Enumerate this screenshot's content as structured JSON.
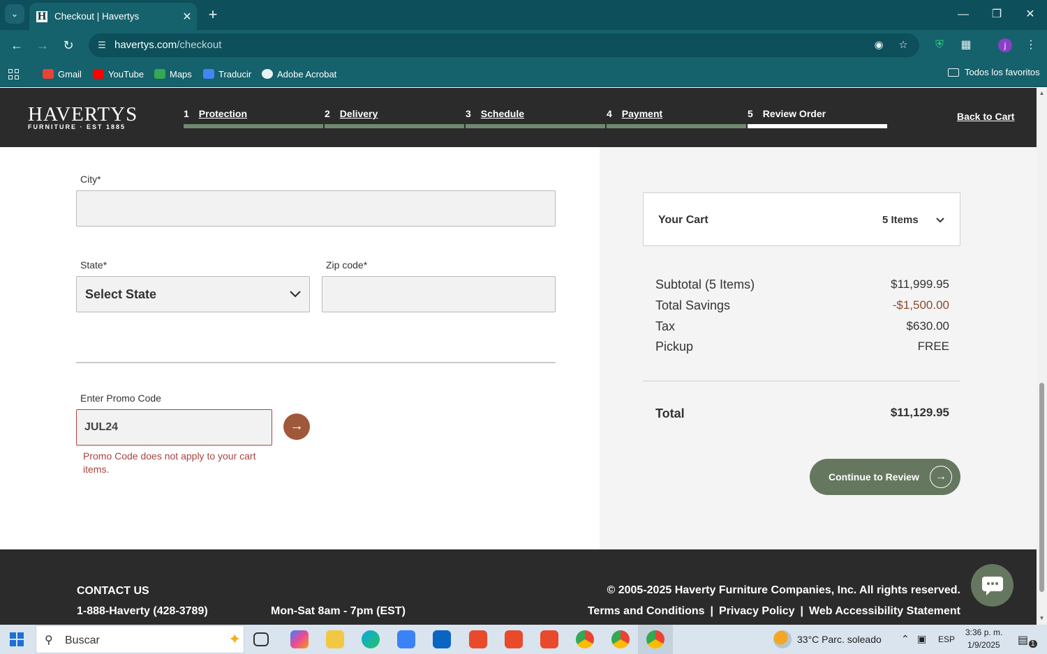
{
  "browser": {
    "tab_title": "Checkout | Havertys",
    "favicon_letter": "H",
    "url_host": "havertys.com",
    "url_path": "/checkout",
    "profile_initial": "j",
    "bookmarks": [
      "Gmail",
      "YouTube",
      "Maps",
      "Traducir",
      "Adobe Acrobat"
    ],
    "bookmarks_folder": "Todos los favoritos"
  },
  "header": {
    "logo": "HAVERTYS",
    "logo_sub": "FURNITURE · EST 1885",
    "steps": [
      {
        "num": "1",
        "label": "Protection"
      },
      {
        "num": "2",
        "label": "Delivery"
      },
      {
        "num": "3",
        "label": "Schedule"
      },
      {
        "num": "4",
        "label": "Payment"
      },
      {
        "num": "5",
        "label": "Review Order"
      }
    ],
    "back_to_cart": "Back to Cart"
  },
  "form": {
    "city_label": "City*",
    "city_value": "",
    "state_label": "State*",
    "state_value": "Select State",
    "zip_label": "Zip code*",
    "zip_value": "",
    "promo_label": "Enter Promo Code",
    "promo_value": "JUL24",
    "promo_error": "Promo Code does not apply to your cart items."
  },
  "summary": {
    "cart_title": "Your Cart",
    "cart_count": "5 Items",
    "rows": [
      {
        "label": "Subtotal (5 Items)",
        "value": "$11,999.95"
      },
      {
        "label": "Total Savings",
        "value": "-$1,500.00"
      },
      {
        "label": "Tax",
        "value": "$630.00"
      },
      {
        "label": "Pickup",
        "value": "FREE"
      }
    ],
    "total_label": "Total",
    "total_value": "$11,129.95",
    "continue_label": "Continue to Review"
  },
  "footer": {
    "contact_title": "CONTACT US",
    "phone": "1-888-Haverty (428-3789)",
    "hours": "Mon-Sat 8am - 7pm (EST)",
    "copyright": "© 2005-2025 Haverty Furniture Companies, Inc. All rights reserved.",
    "links": [
      "Terms and Conditions",
      "Privacy Policy",
      "Web Accessibility Statement"
    ]
  },
  "taskbar": {
    "search_placeholder": "Buscar",
    "weather": "33°C  Parc. soleado",
    "language": "ESP",
    "time": "3:36 p. m.",
    "date": "1/9/2025",
    "notifications": "1"
  },
  "colors": {
    "chrome_dark": "#0d4f5a",
    "chrome": "#15616c",
    "header_bg": "#2b2b2b",
    "step_bar": "#6f8a6f",
    "accent_green": "#66775f",
    "promo_button": "#a0583a",
    "error_red": "#a94442",
    "savings": "#8c4a2f"
  }
}
